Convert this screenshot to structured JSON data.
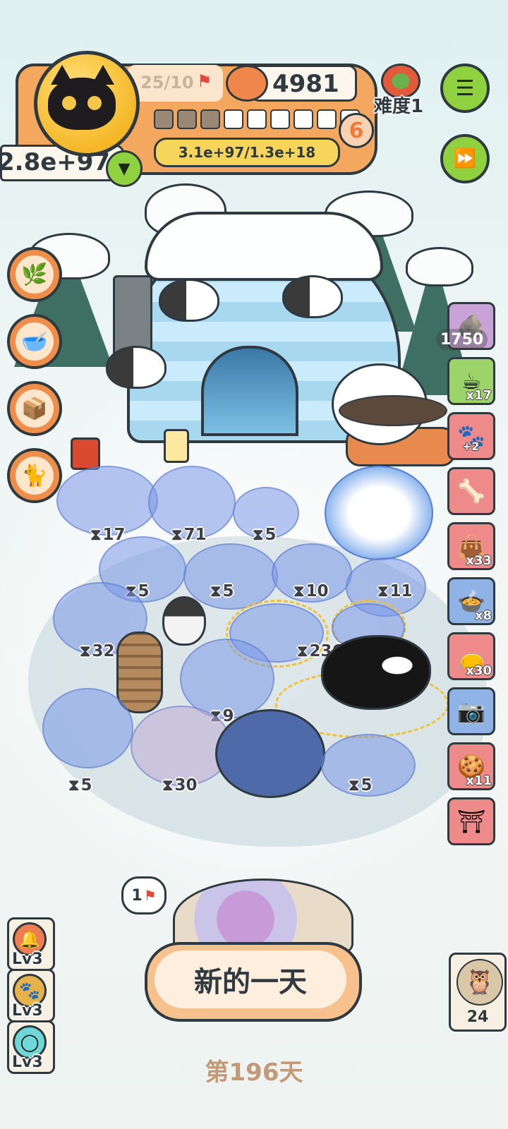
{
  "hud": {
    "flag_progress": "25/10",
    "coins": "4981",
    "difficulty": "难度1",
    "score": "2.8e+97",
    "progress_text": "3.1e+97/1.3e+18",
    "level_number": "6",
    "level_fill_fraction": 0.3
  },
  "side_items": [
    {
      "icon": "boulder-icon",
      "value": "1750"
    },
    {
      "icon": "tea-cup-icon",
      "value": "x17"
    },
    {
      "icon": "paw-plus-icon",
      "value": "+2"
    },
    {
      "icon": "fish-skeleton-icon",
      "value": ""
    },
    {
      "icon": "bag-icon",
      "value": "x33"
    },
    {
      "icon": "pot-icon",
      "value": "x8"
    },
    {
      "icon": "red-pouch-icon",
      "value": "x30"
    },
    {
      "icon": "camera-icon",
      "value": ""
    },
    {
      "icon": "cookie-icon",
      "value": "x11"
    },
    {
      "icon": "shrine-icon",
      "value": ""
    }
  ],
  "upgrades": [
    "plant-icon",
    "bowl-icon",
    "box-icon",
    "cat-tree-icon"
  ],
  "units": {
    "row1": [
      "17",
      "71",
      "5"
    ],
    "row2": [
      "5",
      "5",
      "10",
      "11"
    ],
    "row3": [
      "32",
      "236"
    ],
    "row4": [
      "9"
    ],
    "row5": [
      "5",
      "30",
      "5"
    ]
  },
  "bottom": {
    "flag_bubble": "1",
    "skills": [
      "Lv3",
      "Lv3",
      "Lv3"
    ],
    "new_day_label": "新的一天",
    "day_counter": "第196天",
    "pet_count": "24"
  },
  "colors": {
    "hud_orange": "#f4a85f",
    "accent_green": "#8fd13f",
    "unit_blue": "#7a98e6"
  }
}
